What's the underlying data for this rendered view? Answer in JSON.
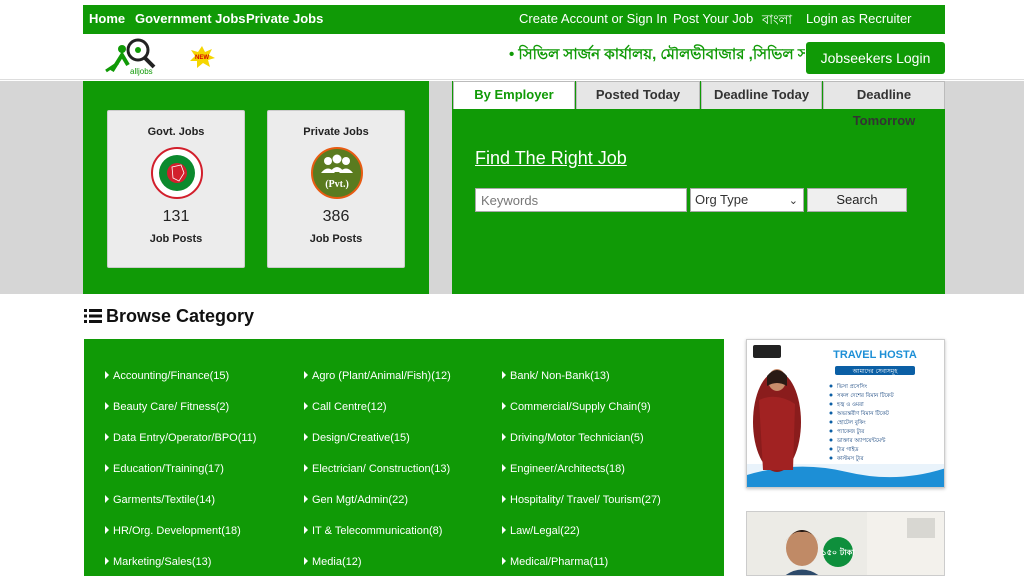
{
  "topnav": {
    "home": "Home",
    "government_jobs": "Government Jobs",
    "private_jobs": "Private Jobs",
    "create_account": "Create Account or Sign In",
    "post_job": "Post Your Job",
    "bangla": "বাংলা",
    "recruiter_login": "Login as Recruiter"
  },
  "header": {
    "logo_text": "alljobs",
    "new_badge": "NEW",
    "ticker": "• সিভিল সার্জন কার্যালয়, মৌলভীবাজার ,সিভিল সার্জন কার্যালয়",
    "jobseekers_login": "Jobseekers Login"
  },
  "cards": [
    {
      "title": "Govt. Jobs",
      "count": "131",
      "label": "Job Posts"
    },
    {
      "title": "Private Jobs",
      "count": "386",
      "label": "Job Posts"
    }
  ],
  "private_icon_text": "(Pvt.)",
  "tabs": [
    "By Employer",
    "Posted Today",
    "Deadline Today",
    "Deadline Tomorrow"
  ],
  "search": {
    "title": "Find The Right Job",
    "keywords_placeholder": "Keywords",
    "org_type": "Org Type",
    "button": "Search"
  },
  "browse": {
    "title": "Browse Category",
    "categories": [
      [
        "Accounting/Finance(15)",
        "Agro (Plant/Animal/Fish)(12)",
        "Bank/ Non-Bank(13)"
      ],
      [
        "Beauty Care/ Fitness(2)",
        "Call Centre(12)",
        "Commercial/Supply Chain(9)"
      ],
      [
        "Data Entry/Operator/BPO(11)",
        "Design/Creative(15)",
        "Driving/Motor Technician(5)"
      ],
      [
        "Education/Training(17)",
        "Electrician/ Construction(13)",
        "Engineer/Architects(18)"
      ],
      [
        "Garments/Textile(14)",
        "Gen Mgt/Admin(22)",
        "Hospitality/ Travel/ Tourism(27)"
      ],
      [
        "HR/Org. Development(18)",
        "IT & Telecommunication(8)",
        "Law/Legal(22)"
      ],
      [
        "Marketing/Sales(13)",
        "Media(12)",
        "Medical/Pharma(11)"
      ]
    ]
  },
  "ads": {
    "travel_title": "TRAVEL HOSTA",
    "travel_subtitle": "আমাদের সেবাসমূহ",
    "travel_services": [
      "ভিসা প্রসেসিং",
      "সকল দেশের বিমান টিকেট",
      "হজ্ব ও ওমরা",
      "অভ্যন্তরীণ বিমান টিকেট",
      "হোটেল বুকিং",
      "প্যাকেজ ট্যুর",
      "ডাক্তার অ্যাপয়েন্টমেন্ট",
      "ট্যুর গাইড",
      "কাস্টমস ট্যুর"
    ],
    "ad2_badge": "১৫০ টাকা"
  },
  "colors": {
    "brand_green": "#109a06",
    "hero_bg": "#d6d6d6"
  }
}
